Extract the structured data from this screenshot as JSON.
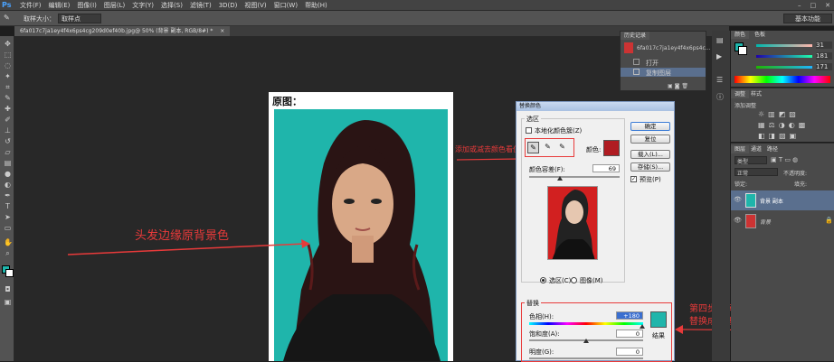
{
  "app": {
    "logo": "Ps",
    "menus": [
      "文件(F)",
      "编辑(E)",
      "图像(I)",
      "图层(L)",
      "文字(Y)",
      "选择(S)",
      "滤镜(T)",
      "3D(D)",
      "视图(V)",
      "窗口(W)",
      "帮助(H)"
    ],
    "workspace": "基本功能"
  },
  "options": {
    "sample_size_label": "取样大小：",
    "sample_size_value": "取样点"
  },
  "document": {
    "tab": "6fa017c7ja1ey4f4x6ps4cg209d0ef40b.jpg@ 50% (背景 副本, RGB/8#) *",
    "title": "原图："
  },
  "annotations": {
    "left": "头发边缘原背景色",
    "middle": "添加或减去颜色看值",
    "right_line1": "第四步:调动色相值,",
    "right_line2": "替换成你想要的背景颜色"
  },
  "dialog": {
    "title": "替换颜色",
    "selection_legend": "选区",
    "localized_clusters": "本地化颜色簇(Z)",
    "color_label": "颜色:",
    "fuzziness_label": "颜色容差(F):",
    "fuzziness_value": "69",
    "radio_selection": "选区(C)",
    "radio_image": "图像(M)",
    "ok": "确定",
    "reset": "复位",
    "load": "载入(L)...",
    "save": "存储(S)...",
    "preview": "预览(P)",
    "replace_legend": "替换",
    "hue_label": "色相(H):",
    "hue_value": "+180",
    "sat_label": "饱和度(A):",
    "sat_value": "0",
    "light_label": "明度(G):",
    "light_value": "0",
    "result_label": "结果",
    "swatch_color": "#b01c22",
    "result_color": "#1fb5ab"
  },
  "history": {
    "title": "历史记录",
    "file": "6fa017c7ja1ey4f4x6ps4c...",
    "items": [
      "打开",
      "复制图层"
    ]
  },
  "color_panel": {
    "tabs": [
      "颜色",
      "色板"
    ],
    "values": [
      "31",
      "181",
      "171"
    ]
  },
  "adjustments": {
    "tabs": [
      "调整",
      "样式"
    ],
    "title": "添加调整"
  },
  "layers": {
    "tabs": [
      "图层",
      "通道",
      "路径"
    ],
    "kind": "类型",
    "mode": "正常",
    "opacity_label": "不透明度:",
    "lock_label": "锁定:",
    "fill_label": "填充:",
    "items": [
      {
        "name": "背景 副本"
      },
      {
        "name": "背景"
      }
    ]
  },
  "colors": {
    "teal": "#1fb5ab",
    "red": "#e83a3a"
  }
}
